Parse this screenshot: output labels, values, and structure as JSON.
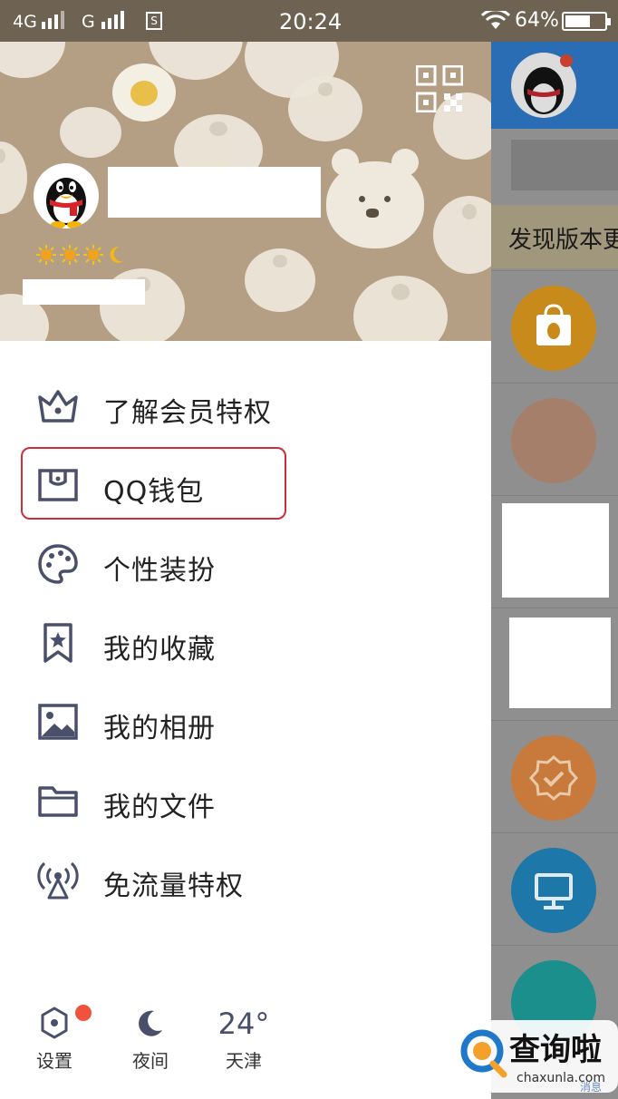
{
  "status_bar": {
    "network_1": "4G",
    "network_2": "G",
    "sim_badge": "S",
    "time": "20:24",
    "battery": "64%",
    "battery_fraction": 0.64
  },
  "drawer": {
    "qr_icon": "qr-code-icon",
    "level_icons": [
      "sun-icon",
      "sun-icon",
      "sun-icon",
      "moon-icon"
    ],
    "menu": [
      {
        "label": "了解会员特权",
        "icon": "crown-icon"
      },
      {
        "label": "QQ钱包",
        "icon": "wallet-icon"
      },
      {
        "label": "个性装扮",
        "icon": "palette-icon"
      },
      {
        "label": "我的收藏",
        "icon": "bookmark-star-icon"
      },
      {
        "label": "我的相册",
        "icon": "image-icon"
      },
      {
        "label": "我的文件",
        "icon": "folder-icon"
      },
      {
        "label": "免流量特权",
        "icon": "signal-tower-icon"
      }
    ],
    "bottom": {
      "settings_label": "设置",
      "night_label": "夜间",
      "temperature": "24°",
      "city": "天津"
    }
  },
  "background_screen": {
    "notice_text": "发现版本更"
  },
  "watermark": {
    "brand": "查询啦",
    "url": "chaxunla.com",
    "tab_fragment": "消息"
  },
  "colors": {
    "header_bg": "#b49f84",
    "highlight": "#cc2e3b",
    "icon": "#4a4f6a",
    "badge": "#f0533b"
  }
}
